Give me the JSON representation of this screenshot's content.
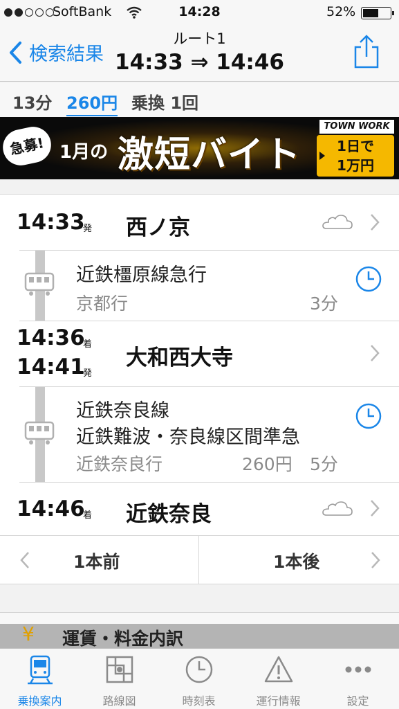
{
  "status_bar": {
    "carrier": "SoftBank",
    "time": "14:28",
    "battery": "52%",
    "battery_level": 0.52
  },
  "nav": {
    "back_label": "検索結果",
    "title": "ルート1",
    "subtitle": "14:33 ⇒ 14:46"
  },
  "summary": {
    "duration": "13分",
    "fare": "260円",
    "transfer": "乗換 1回"
  },
  "banner": {
    "bubble": "急募!",
    "month": "1月の",
    "headline": "激短バイト",
    "brand": "TOWN WORK",
    "tag_line1": "1日で",
    "tag_line2": "1万円"
  },
  "route": {
    "stations": [
      {
        "time": "14:33",
        "mark": "発",
        "name": "西ノ京"
      },
      {
        "time": "14:36",
        "mark": "着",
        "time2": "14:41",
        "mark2": "発",
        "name": "大和西大寺"
      },
      {
        "time": "14:46",
        "mark": "着",
        "name": "近鉄奈良"
      }
    ],
    "segments": [
      {
        "line": "近鉄橿原線急行",
        "dest": "京都行",
        "duration": "3分"
      },
      {
        "line": "近鉄奈良線",
        "line2": "近鉄難波・奈良線区間準急",
        "dest": "近鉄奈良行",
        "fare": "260円",
        "duration": "5分"
      }
    ]
  },
  "pager": {
    "prev": "1本前",
    "next": "1本後"
  },
  "fare_section": {
    "yen_icon": "¥",
    "title": "運賃・料金内訳"
  },
  "tabs": [
    {
      "label": "乗換案内",
      "icon": "train-icon",
      "active": true
    },
    {
      "label": "路線図",
      "icon": "map-icon",
      "active": false
    },
    {
      "label": "時刻表",
      "icon": "clock-icon",
      "active": false
    },
    {
      "label": "運行情報",
      "icon": "warning-icon",
      "active": false
    },
    {
      "label": "設定",
      "icon": "more-icon",
      "active": false
    }
  ],
  "colors": {
    "accent": "#1a86e8",
    "banner_gold": "#f5b800"
  }
}
